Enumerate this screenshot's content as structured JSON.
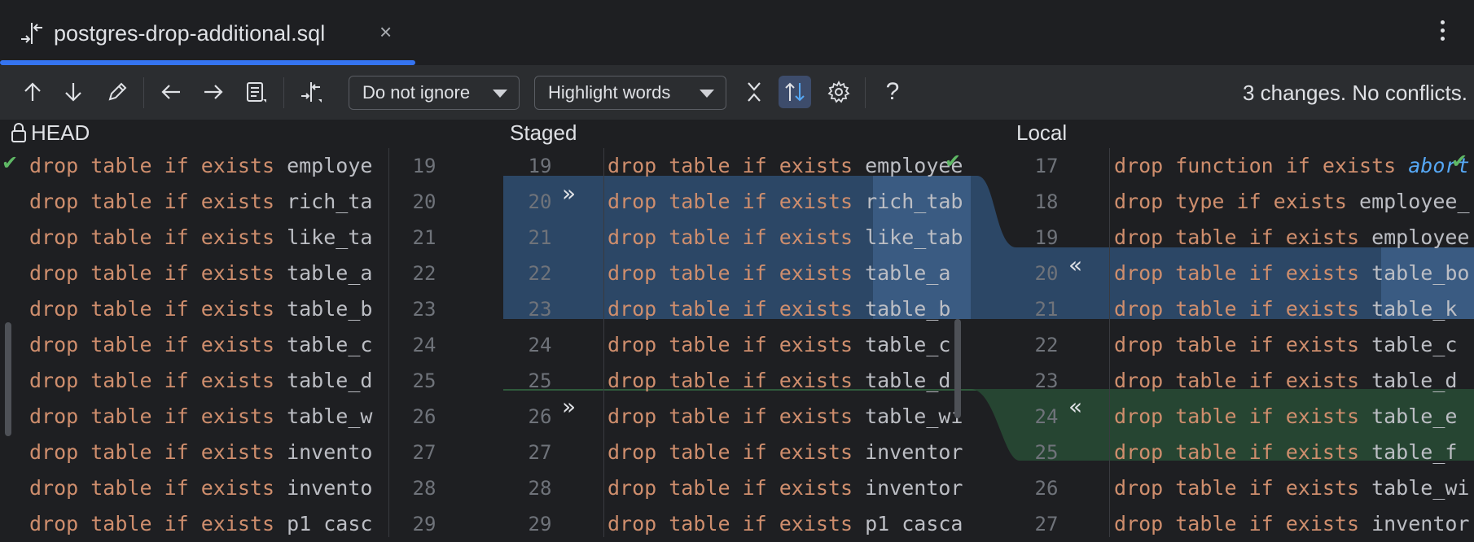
{
  "tab": {
    "title": "postgres-drop-additional.sql",
    "close": "×"
  },
  "toolbar": {
    "ignore_dropdown": "Do not ignore",
    "highlight_dropdown": "Highlight words",
    "help": "?",
    "status": "3 changes. No conflicts."
  },
  "headers": {
    "left": "HEAD",
    "middle": "Staged",
    "right": "Local"
  },
  "left_pane": {
    "lines": [
      [
        "drop table if exists ",
        "employe"
      ],
      [
        "drop table if exists ",
        "rich_ta"
      ],
      [
        "drop table if exists ",
        "like_ta"
      ],
      [
        "drop table if exists ",
        "table_a"
      ],
      [
        "drop table if exists ",
        "table_b"
      ],
      [
        "drop table if exists ",
        "table_c"
      ],
      [
        "drop table if exists ",
        "table_d"
      ],
      [
        "drop table if exists ",
        "table_w"
      ],
      [
        "drop table if exists ",
        "invento"
      ],
      [
        "drop table if exists ",
        "invento"
      ],
      [
        "drop table if exists ",
        "p1 casc"
      ]
    ],
    "numbers": [
      "19",
      "20",
      "21",
      "22",
      "23",
      "24",
      "25",
      "26",
      "27",
      "28",
      "29"
    ]
  },
  "middle_pane": {
    "left_numbers": [
      "19",
      "20",
      "21",
      "22",
      "23",
      "24",
      "25",
      "26",
      "27",
      "28",
      "29"
    ],
    "lines": [
      [
        "drop table if exists ",
        "employee"
      ],
      [
        "drop table if exists ",
        "rich_tab"
      ],
      [
        "drop table if exists ",
        "like_tab"
      ],
      [
        "drop table if exists ",
        "table_a"
      ],
      [
        "drop table if exists ",
        "table_b"
      ],
      [
        "drop table if exists ",
        "table_c"
      ],
      [
        "drop table if exists ",
        "table_d"
      ],
      [
        "drop table if exists ",
        "table_wi"
      ],
      [
        "drop table if exists ",
        "inventor"
      ],
      [
        "drop table if exists ",
        "inventor"
      ],
      [
        "drop table if exists ",
        "p1 casca"
      ]
    ],
    "arrow_right": "»"
  },
  "right_pane": {
    "numbers": [
      "17",
      "18",
      "19",
      "20",
      "21",
      "22",
      "23",
      "24",
      "25",
      "26",
      "27"
    ],
    "lines": [
      [
        "drop function if exists ",
        "abort"
      ],
      [
        "drop type if exists ",
        "employee_"
      ],
      [
        "drop table if exists ",
        "employee"
      ],
      [
        "drop table if exists ",
        "table_bo"
      ],
      [
        "drop table if exists ",
        "table_k"
      ],
      [
        "drop table if exists ",
        "table_c"
      ],
      [
        "drop table if exists ",
        "table_d"
      ],
      [
        "drop table if exists ",
        "table_e"
      ],
      [
        "drop table if exists ",
        "table_f"
      ],
      [
        "drop table if exists ",
        "table_wi"
      ],
      [
        "drop table if exists ",
        "inventor"
      ]
    ],
    "arrow_left": "«"
  },
  "colors": {
    "keyword": "#cf8e6d",
    "accent": "#3574f0",
    "change_blue": "#2c4766",
    "change_green": "#264532"
  }
}
